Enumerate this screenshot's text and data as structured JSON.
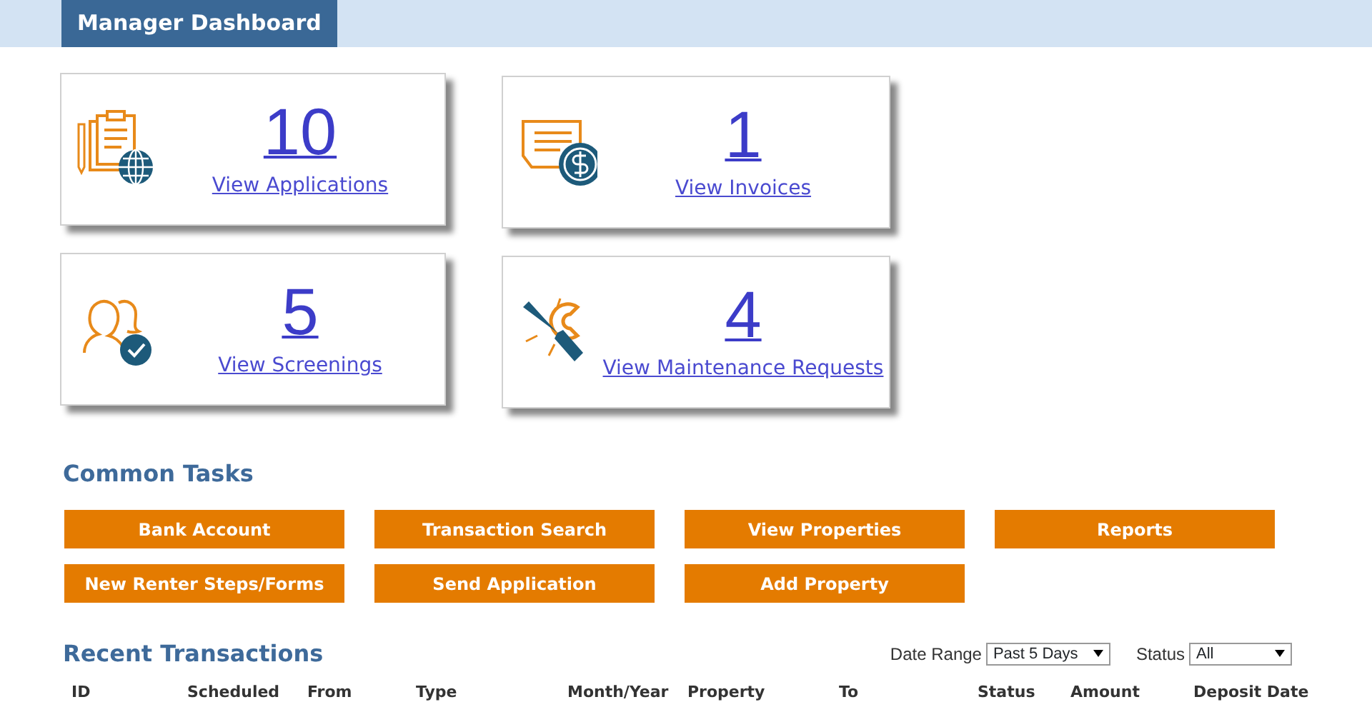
{
  "header": {
    "title": "Manager Dashboard"
  },
  "summary_cards": [
    {
      "kind": "applications",
      "count": "10",
      "link": "View Applications"
    },
    {
      "kind": "invoices",
      "count": "1",
      "link": "View Invoices"
    },
    {
      "kind": "screenings",
      "count": "5",
      "link": "View Screenings"
    },
    {
      "kind": "maintenance",
      "count": "4",
      "link": "View Maintenance Requests"
    }
  ],
  "common_tasks": {
    "title": "Common Tasks",
    "buttons": [
      "Bank Account",
      "Transaction Search",
      "View Properties",
      "Reports",
      "New Renter Steps/Forms",
      "Send Application",
      "Add Property"
    ]
  },
  "recent_transactions": {
    "title": "Recent Transactions",
    "filters": [
      {
        "label": "Date Range",
        "value": "Past 5 Days"
      },
      {
        "label": "Status",
        "value": "All"
      }
    ],
    "columns": [
      "ID",
      "Scheduled",
      "From",
      "Type",
      "Month/Year",
      "Property",
      "To",
      "Status",
      "Amount",
      "Deposit Date"
    ]
  }
}
